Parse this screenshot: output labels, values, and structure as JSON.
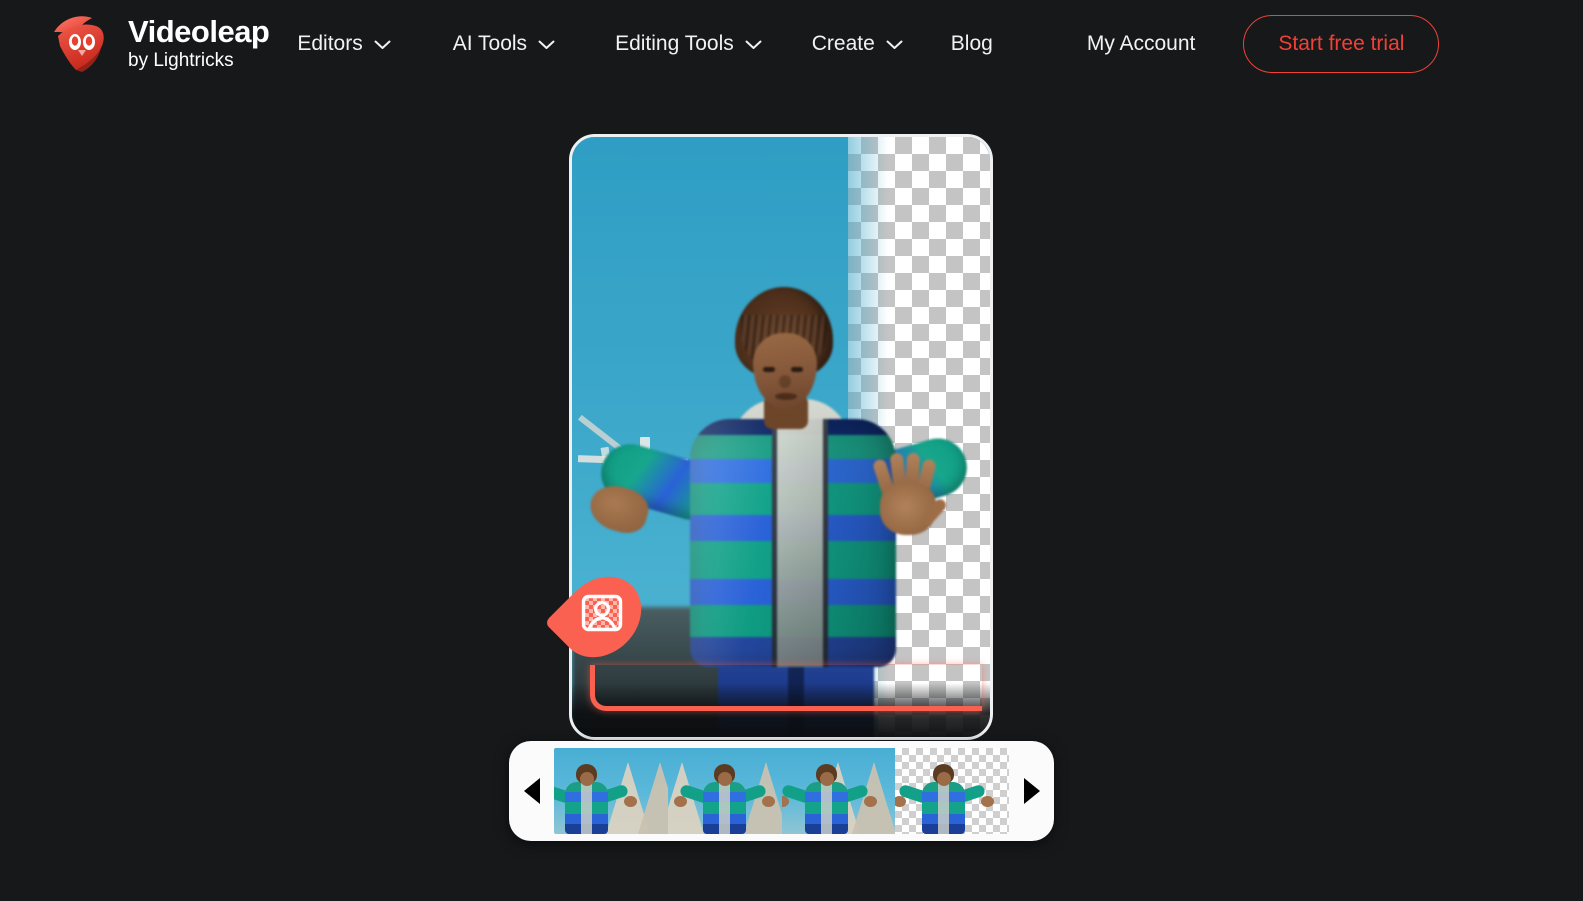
{
  "colors": {
    "page_background": "#16181a",
    "accent_red": "#ef4136",
    "pin_coral": "#fb6150",
    "track_line": "#f9604f",
    "text_white": "#ffffff",
    "sky_blue": "#3aa6c9",
    "jacket_teal": "#12a38a",
    "jacket_blue": "#2a62d8"
  },
  "header": {
    "brand": {
      "logo_icon": "videoleap-bird-logo-icon",
      "name": "Videoleap",
      "subtitle": "by Lightricks"
    },
    "nav": [
      {
        "label": "Editors",
        "has_dropdown": true,
        "icon": "chevron-down-icon"
      },
      {
        "label": "AI Tools",
        "has_dropdown": true,
        "icon": "chevron-down-icon"
      },
      {
        "label": "Editing Tools",
        "has_dropdown": true,
        "icon": "chevron-down-icon"
      },
      {
        "label": "Create",
        "has_dropdown": true,
        "icon": "chevron-down-icon"
      },
      {
        "label": "Blog",
        "has_dropdown": false,
        "icon": ""
      },
      {
        "label": "My Account",
        "has_dropdown": false,
        "icon": ""
      }
    ],
    "cta": {
      "label": "Start free trial"
    }
  },
  "preview": {
    "marker": {
      "icon": "remove-background-person-icon",
      "color": "#fb6150"
    },
    "track": {
      "color": "#f9604f"
    },
    "canvas": {
      "left_region": "original-video",
      "right_region": "transparent-checkerboard"
    }
  },
  "filmstrip": {
    "prev_icon": "arrow-left-triangle-icon",
    "next_icon": "arrow-right-triangle-icon",
    "frames": [
      {
        "name": "frame-1",
        "transparent": false
      },
      {
        "name": "frame-2",
        "transparent": false
      },
      {
        "name": "frame-3",
        "transparent": false
      },
      {
        "name": "frame-4",
        "transparent": true
      }
    ]
  }
}
